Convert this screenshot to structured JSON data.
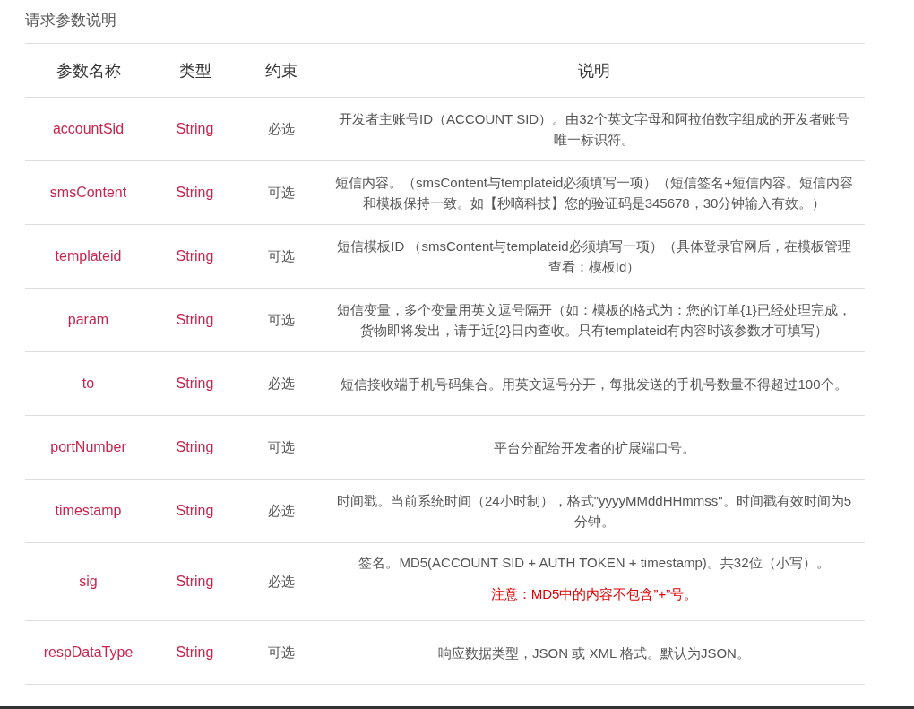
{
  "title": "请求参数说明",
  "table": {
    "columns": [
      "参数名称",
      "类型",
      "约束",
      "说明"
    ],
    "rows": [
      {
        "name": "accountSid",
        "type": "String",
        "constraint": "必选",
        "description": "开发者主账号ID（ACCOUNT SID）。由32个英文字母和阿拉伯数字组成的开发者账号唯一标识符。"
      },
      {
        "name": "smsContent",
        "type": "String",
        "constraint": "可选",
        "description": "短信内容。（smsContent与templateid必须填写一项）（短信签名+短信内容。短信内容和模板保持一致。如【秒嘀科技】您的验证码是345678，30分钟输入有效。）"
      },
      {
        "name": "templateid",
        "type": "String",
        "constraint": "可选",
        "description": "短信模板ID （smsContent与templateid必须填写一项）（具体登录官网后，在模板管理查看：模板Id）"
      },
      {
        "name": "param",
        "type": "String",
        "constraint": "可选",
        "description": "短信变量，多个变量用英文逗号隔开（如：模板的格式为：您的订单{1}已经处理完成，货物即将发出，请于近{2}日内查收。只有templateid有内容时该参数才可填写）"
      },
      {
        "name": "to",
        "type": "String",
        "constraint": "必选",
        "description": "短信接收端手机号码集合。用英文逗号分开，每批发送的手机号数量不得超过100个。"
      },
      {
        "name": "portNumber",
        "type": "String",
        "constraint": "可选",
        "description": "平台分配给开发者的扩展端口号。"
      },
      {
        "name": "timestamp",
        "type": "String",
        "constraint": "必选",
        "description": "时间戳。当前系统时间（24小时制），格式\"yyyyMMddHHmmss\"。时间戳有效时间为5分钟。"
      },
      {
        "name": "sig",
        "type": "String",
        "constraint": "必选",
        "description": "签名。MD5(ACCOUNT SID + AUTH TOKEN + timestamp)。共32位（小写）。",
        "note": "注意：MD5中的内容不包含”+”号。"
      },
      {
        "name": "respDataType",
        "type": "String",
        "constraint": "可选",
        "description": "响应数据类型，JSON 或 XML 格式。默认为JSON。"
      }
    ]
  }
}
